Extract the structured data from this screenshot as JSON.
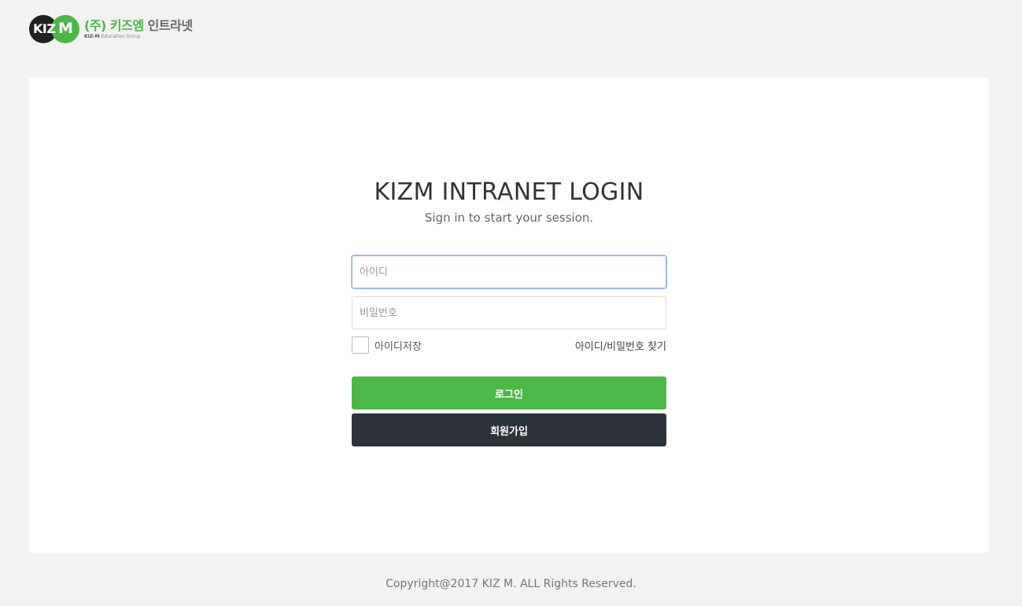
{
  "logo": {
    "mark_left": "KIZ",
    "mark_right": "M",
    "title_prefix": "(주) 키즈엠",
    "title_suffix": "인트라넷",
    "subtitle_bold": "KIZ-M",
    "subtitle_rest": "Education Group"
  },
  "login": {
    "title": "KIZM INTRANET LOGIN",
    "subtitle": "Sign in to start your session.",
    "id_value": "",
    "id_placeholder": "아이디",
    "pw_value": "",
    "pw_placeholder": "비밀번호",
    "remember_label": "아이디저장",
    "remember_checked": false,
    "find_link": "아이디/비밀번호 찾기",
    "login_button": "로그인",
    "join_button": "회원가입"
  },
  "footer": {
    "copyright": "Copyright@2017 KIZ M. ALL Rights Reserved."
  },
  "colors": {
    "background": "#f2f2f2",
    "card": "#ffffff",
    "brand_green": "#4cb848",
    "dark_button": "#2d3339",
    "focus_border": "#8fb0f5"
  }
}
